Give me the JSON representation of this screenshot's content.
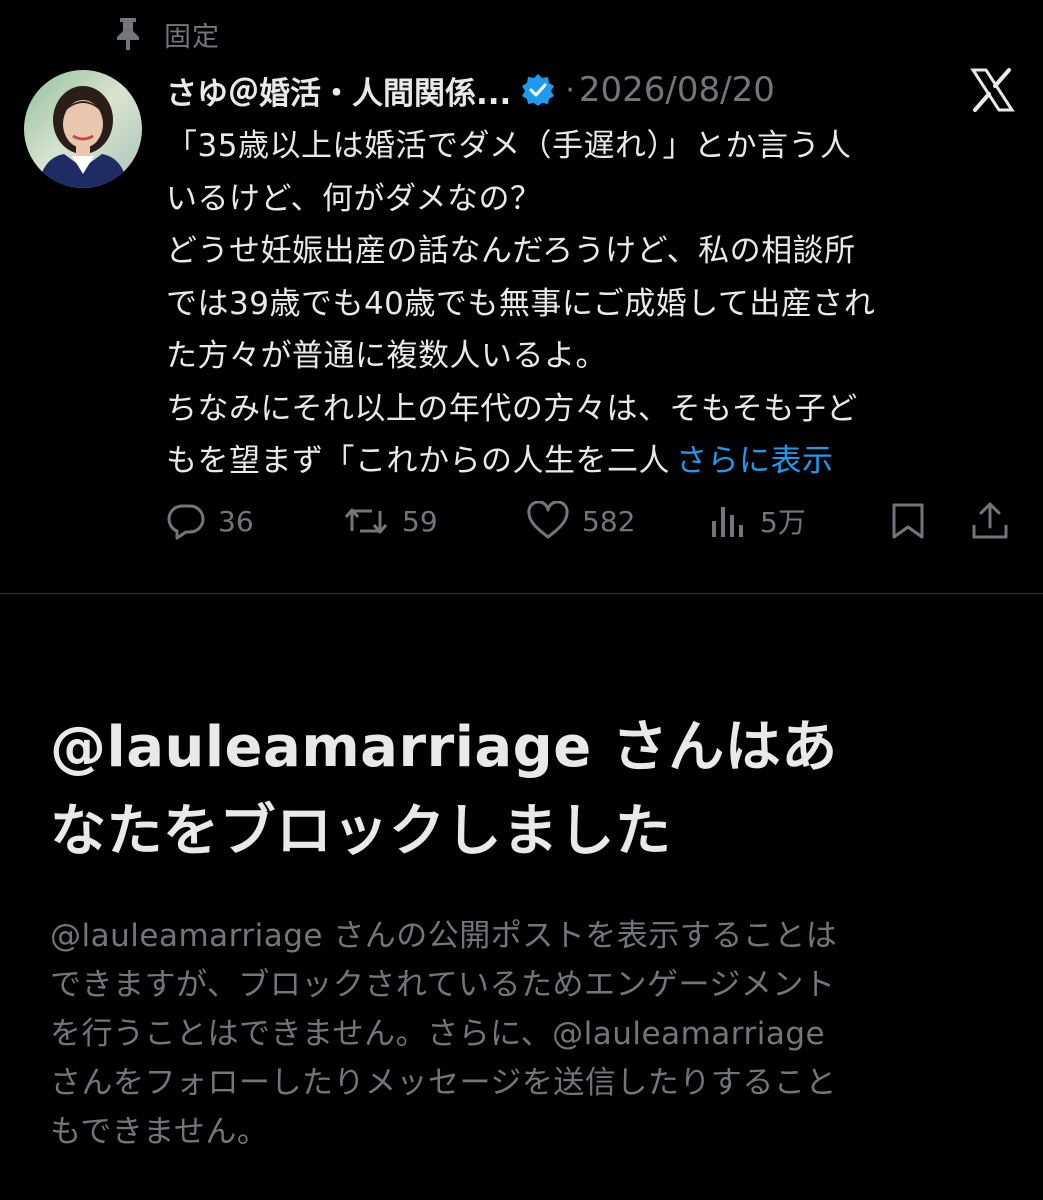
{
  "pinned": {
    "label": "固定"
  },
  "post": {
    "display_name": "さゆ＠婚活・人間関係...",
    "separator": "·",
    "date": "2026/08/20",
    "lines": [
      "「35歳以上は婚活でダメ（手遅れ）」とか言う人",
      "いるけど、何がダメなの？",
      "どうせ妊娠出産の話なんだろうけど、私の相談所",
      "では39歳でも40歳でも無事にご成婚して出産され",
      "た方々が普通に複数人いるよ。",
      "ちなみにそれ以上の年代の方々は、そもそも子ど",
      "もを望まず「これからの人生を二人"
    ],
    "show_more": "さらに表示",
    "actions": {
      "replies": "36",
      "reposts": "59",
      "likes": "582",
      "views": "5万"
    }
  },
  "blocked": {
    "title_lines": [
      "@lauleamarriage さんはあ",
      "なたをブロックしました"
    ],
    "desc_lines": [
      "@lauleamarriage さんの公開ポストを表示することは",
      "できますが、ブロックされているためエンゲージメント",
      "を行うことはできません。さらに、@lauleamarriage",
      "さんをフォローしたりメッセージを送信したりすること",
      "もできません。"
    ]
  },
  "colors": {
    "background": "#000000",
    "text_primary": "#e7e9ea",
    "text_secondary": "#71767b",
    "link_blue": "#1d9bf0",
    "verified_blue": "#1d9bf0"
  },
  "icons": {
    "pin": "pin-icon",
    "verified": "verified-badge-icon",
    "logo": "x-logo-icon",
    "reply": "reply-icon",
    "repost": "repost-icon",
    "like": "heart-icon",
    "views": "views-icon",
    "bookmark": "bookmark-icon",
    "share": "share-icon"
  }
}
